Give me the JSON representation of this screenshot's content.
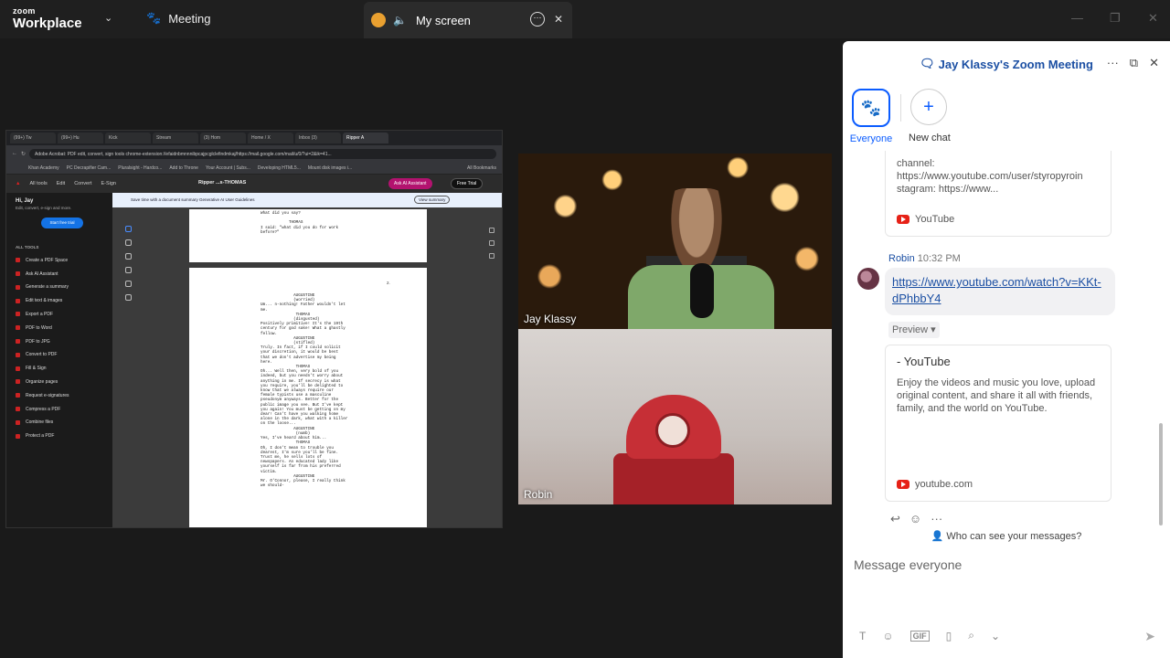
{
  "topbar": {
    "brand_top": "zoom",
    "brand_bottom": "Workplace",
    "meeting_label": "Meeting",
    "screen_label": "My screen"
  },
  "share": {
    "tabs": [
      "(99+) Tw",
      "(99+) Hu",
      "Kick",
      "Stream",
      "(3) Hom",
      "Home / X",
      "Inbox (3)",
      "Ripper A"
    ],
    "url": "Adobe Acrobat: PDF edit, convert, sign tools   chrome-extension://efaidnbmnnnibpcajpcglclefindmkaj/https://mail.google.com/mail/u/0/?ui=2&ik=41...",
    "bookmarks": [
      "Khan Academy",
      "PC Decrapifier Cam...",
      "Pluralsight - Hardco...",
      "Add to Throne",
      "Your Account | Subs...",
      "Developing HTML5...",
      "Mount disk images i...",
      "All Bookmarks"
    ],
    "acrobat": {
      "menu": [
        "All tools",
        "Edit",
        "Convert",
        "E-Sign"
      ],
      "filename": "Ripper ...s-THOMAS",
      "ask_ai": "Ask AI Assistant",
      "free_trial": "Free Trial",
      "greeting": "Hi, Jay",
      "greeting_sub": "Edit, convert, e-sign and more.",
      "start_trial": "Start free trial",
      "all_tools_header": "ALL TOOLS",
      "tools": [
        "Create a PDF Space",
        "Ask AI Assistant",
        "Generate a summary",
        "Edit text & images",
        "Export a PDF",
        "PDF to Word",
        "PDF to JPG",
        "Convert to PDF",
        "Fill & Sign",
        "Organize pages",
        "Request e-signatures",
        "Compress a PDF",
        "Combine files",
        "Protect a PDF"
      ],
      "banner_text": "Save time with a document summary  Generative AI User Guidelines",
      "banner_button": "View summary",
      "page1_text": "What did you say?\n\n            THOMAS\nI said: \"what did you do for work\nbefore?\"",
      "page_number": "2.",
      "page2_text": "              AUGUSTINE\n              (worried)\nUm... n-nothing! Father wouldn't let\nme.\n               THOMAS\n              (disgusted)\nPositively primitive! It's the 19th\ncentury for god sake! What a ghastly\nfellow.\n              AUGUSTINE\n              (stifled)\nTruly. In fact, if I could solicit\nyour discretion, it would be best\nthat we don't advertise my being\nhere.\n               THOMAS\nOh... Well then, very bold of you\nindeed, but you needn't worry about\nanything in me. If secrecy is what\nyou require, you'll be delighted to\nknow that we always require our\nfemale typists use a masculine\npseudonym anyways. Better for the\npublic image you see. But I've kept\nyou again! You must be getting on my\ndear! Can't have you walking home\nalone in the dark, what with a killer\non the loose...\n              AUGUSTINE\n               (numb)\nYes, I've heard about him...\n               THOMAS\nOh, I don't mean to trouble you\ndearest, I'm sure you'll be fine.\nTrust me, he sells lots of\nnewspapers. An educated lady like\nyourself is far from his preferred\nvictim.\n              AUGUSTINE\nMr. O'Connor, please, I really think\nwe should-"
    }
  },
  "videos": [
    {
      "name": "Jay Klassy"
    },
    {
      "name": "Robin"
    }
  ],
  "chat": {
    "title": "Jay Klassy's Zoom Meeting",
    "channel_everyone": "Everyone",
    "channel_new": "New chat",
    "card1_text": "channel:\nhttps://www.youtube.com/user/styropyroin\nstagram: https://www...",
    "card1_source": "YouTube",
    "sender": "Robin",
    "time": "10:32 PM",
    "link_text": "https://www.youtube.com/watch?v=KKt-dPhbbY4",
    "preview_label": "Preview ▾",
    "card2_title": "- YouTube",
    "card2_desc": "Enjoy the videos and music you love, upload original content, and share it all with friends, family, and the world on YouTube.",
    "card2_source": "youtube.com",
    "who_can_see": "Who can see your messages?",
    "compose_placeholder": "Message everyone",
    "gif_label": "GIF"
  }
}
